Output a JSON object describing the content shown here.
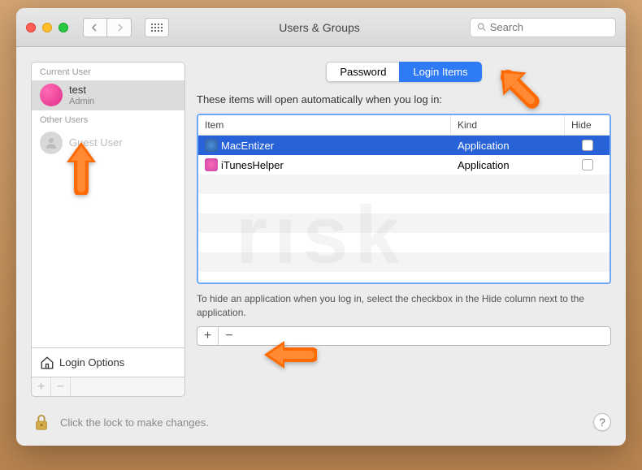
{
  "window": {
    "title": "Users & Groups",
    "search_placeholder": "Search"
  },
  "sidebar": {
    "current_header": "Current User",
    "other_header": "Other Users",
    "users": [
      {
        "name": "test",
        "role": "Admin"
      },
      {
        "name": "Guest User",
        "role": ""
      }
    ],
    "login_options": "Login Options"
  },
  "tabs": {
    "password": "Password",
    "login_items": "Login Items"
  },
  "main": {
    "description": "These items will open automatically when you log in:",
    "columns": {
      "item": "Item",
      "kind": "Kind",
      "hide": "Hide"
    },
    "rows": [
      {
        "name": "MacEntizer",
        "kind": "Application",
        "hide": false,
        "selected": true
      },
      {
        "name": "iTunesHelper",
        "kind": "Application",
        "hide": false,
        "selected": false
      }
    ],
    "hint": "To hide an application when you log in, select the checkbox in the Hide column next to the application.",
    "plus": "+",
    "minus": "−"
  },
  "footer": {
    "lock_text": "Click the lock to make changes.",
    "help": "?"
  }
}
